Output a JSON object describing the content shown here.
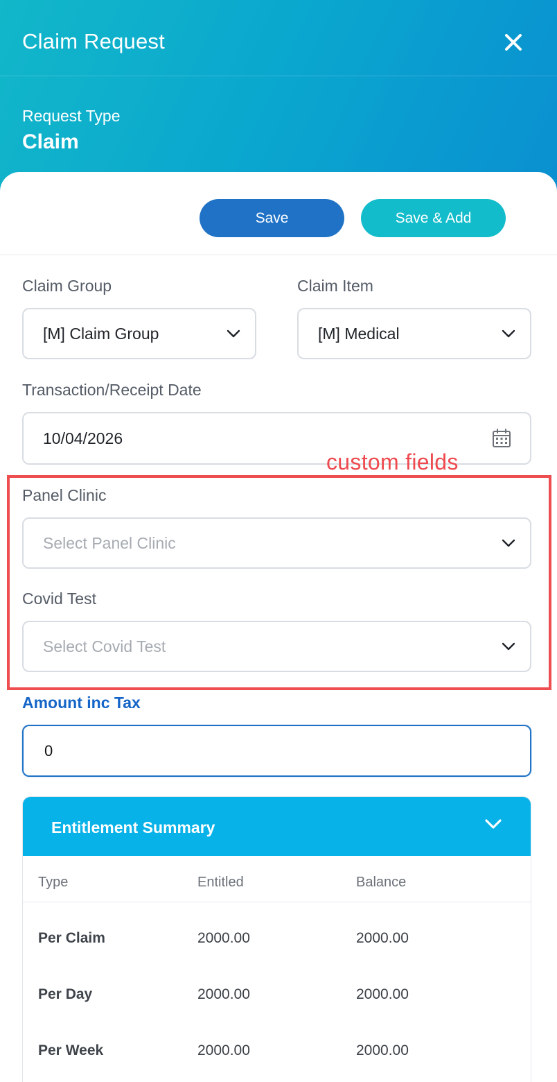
{
  "header": {
    "title": "Claim Request",
    "close_icon": "close-icon",
    "request_type_label": "Request Type",
    "request_type_value": "Claim"
  },
  "actions": {
    "save_label": "Save",
    "save_add_label": "Save & Add"
  },
  "form": {
    "claim_group": {
      "label": "Claim Group",
      "value": "[M] Claim Group"
    },
    "claim_item": {
      "label": "Claim Item",
      "value": "[M] Medical"
    },
    "transaction_date": {
      "label": "Transaction/Receipt Date",
      "value": "10/04/2026",
      "icon": "calendar-icon"
    },
    "custom_fields_note": "custom fields",
    "panel_clinic": {
      "label": "Panel Clinic",
      "placeholder": "Select Panel Clinic"
    },
    "covid_test": {
      "label": "Covid Test",
      "placeholder": "Select Covid Test"
    },
    "amount": {
      "label": "Amount inc Tax",
      "value": "0"
    }
  },
  "entitlement": {
    "title": "Entitlement Summary",
    "columns": [
      "Type",
      "Entitled",
      "Balance"
    ],
    "rows": [
      {
        "type": "Per Claim",
        "entitled": "2000.00",
        "balance": "2000.00"
      },
      {
        "type": "Per Day",
        "entitled": "2000.00",
        "balance": "2000.00"
      },
      {
        "type": "Per Week",
        "entitled": "2000.00",
        "balance": "2000.00"
      }
    ]
  },
  "colors": {
    "header_gradient_start": "#12b7c9",
    "header_gradient_end": "#0a8fd0",
    "save_button": "#1f72c6",
    "save_add_button": "#12bccb",
    "highlight_red": "#ef4e51",
    "amount_label": "#1565c8",
    "entitlement_header": "#06b2e8"
  }
}
